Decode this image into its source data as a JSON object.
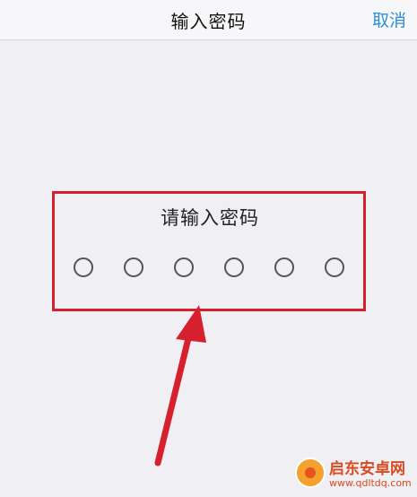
{
  "navbar": {
    "title": "输入密码",
    "cancel_label": "取消"
  },
  "passcode": {
    "prompt": "请输入密码",
    "digits_total": 6,
    "digits_entered": 0
  },
  "annotation": {
    "highlight_color": "#d6202e",
    "arrow_color": "#d6202e"
  },
  "watermark": {
    "name": "启东安卓网",
    "url": "www.qdltdq.com"
  },
  "colors": {
    "background": "#efeff4",
    "accent": "#2d8fd8"
  }
}
